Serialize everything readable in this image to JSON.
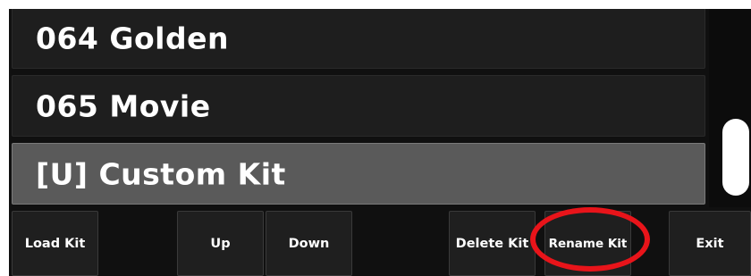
{
  "kits": [
    {
      "label": "064 Golden",
      "selected": false
    },
    {
      "label": "065 Movie",
      "selected": false
    },
    {
      "label": "[U] Custom Kit",
      "selected": true
    }
  ],
  "buttons": {
    "load_kit": "Load Kit",
    "up": "Up",
    "down": "Down",
    "delete_kit": "Delete Kit",
    "rename_kit": "Rename Kit",
    "exit": "Exit"
  },
  "colors": {
    "background": "#101010",
    "item": "#1e1e1e",
    "selected_item": "#5a5a5a",
    "highlight_circle": "#e8141a"
  }
}
